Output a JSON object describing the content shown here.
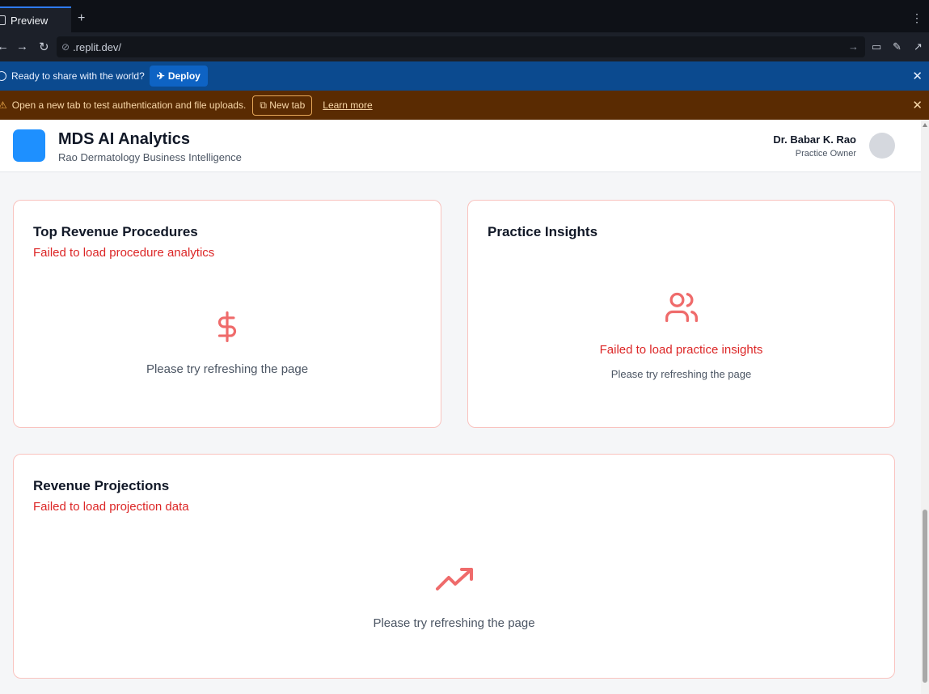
{
  "browser": {
    "tab_label": "Preview",
    "new_tab_symbol": "+",
    "url": ".replit.dev/",
    "kebab": "⋮"
  },
  "deploy_banner": {
    "text": "Ready to share with the world?",
    "button_label": "Deploy"
  },
  "warn_banner": {
    "text": "Open a new tab to test authentication and file uploads.",
    "new_tab_label": "New tab",
    "learn_more_label": "Learn more"
  },
  "header": {
    "title": "MDS AI Analytics",
    "subtitle": "Rao Dermatology Business Intelligence",
    "user_name": "Dr. Babar K. Rao",
    "user_role": "Practice Owner",
    "logo_color": "#1e90ff"
  },
  "cards": {
    "procedures": {
      "title": "Top Revenue Procedures",
      "error": "Failed to load procedure analytics",
      "hint": "Please try refreshing the page",
      "icon": "dollar-icon"
    },
    "insights": {
      "title": "Practice Insights",
      "error": "Failed to load practice insights",
      "hint": "Please try refreshing the page",
      "icon": "users-icon"
    },
    "projections": {
      "title": "Revenue Projections",
      "error": "Failed to load projection data",
      "hint": "Please try refreshing the page",
      "icon": "trending-up-icon"
    }
  },
  "colors": {
    "error": "#dc2626",
    "icon": "#ef6b6b",
    "card_border": "#f9c3bf"
  }
}
